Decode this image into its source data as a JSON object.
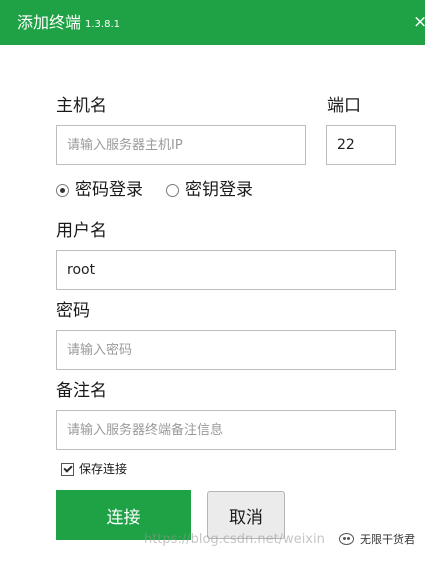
{
  "window": {
    "title": "添加终端",
    "version": "1.3.8.1",
    "close_glyph": "×"
  },
  "form": {
    "host": {
      "label": "主机名",
      "placeholder": "请输入服务器主机IP",
      "value": ""
    },
    "port": {
      "label": "端口",
      "value": "22"
    },
    "auth_mode": {
      "options": [
        {
          "label": "密码登录",
          "selected": true
        },
        {
          "label": "密钥登录",
          "selected": false
        }
      ]
    },
    "username": {
      "label": "用户名",
      "value": "root"
    },
    "password": {
      "label": "密码",
      "placeholder": "请输入密码",
      "value": ""
    },
    "remark": {
      "label": "备注名",
      "placeholder": "请输入服务器终端备注信息",
      "value": ""
    },
    "save_connection": {
      "label": "保存连接",
      "checked": true
    }
  },
  "actions": {
    "connect_label": "连接",
    "cancel_label": "取消"
  },
  "watermark": {
    "url_text": "https://blog.csdn.net/weixin",
    "brand_text": "无限干货君"
  },
  "colors": {
    "accent": "#1ea245",
    "titlebar_text": "#ffffff",
    "border": "#bdbdbd",
    "cancel_bg": "#ebebeb"
  }
}
